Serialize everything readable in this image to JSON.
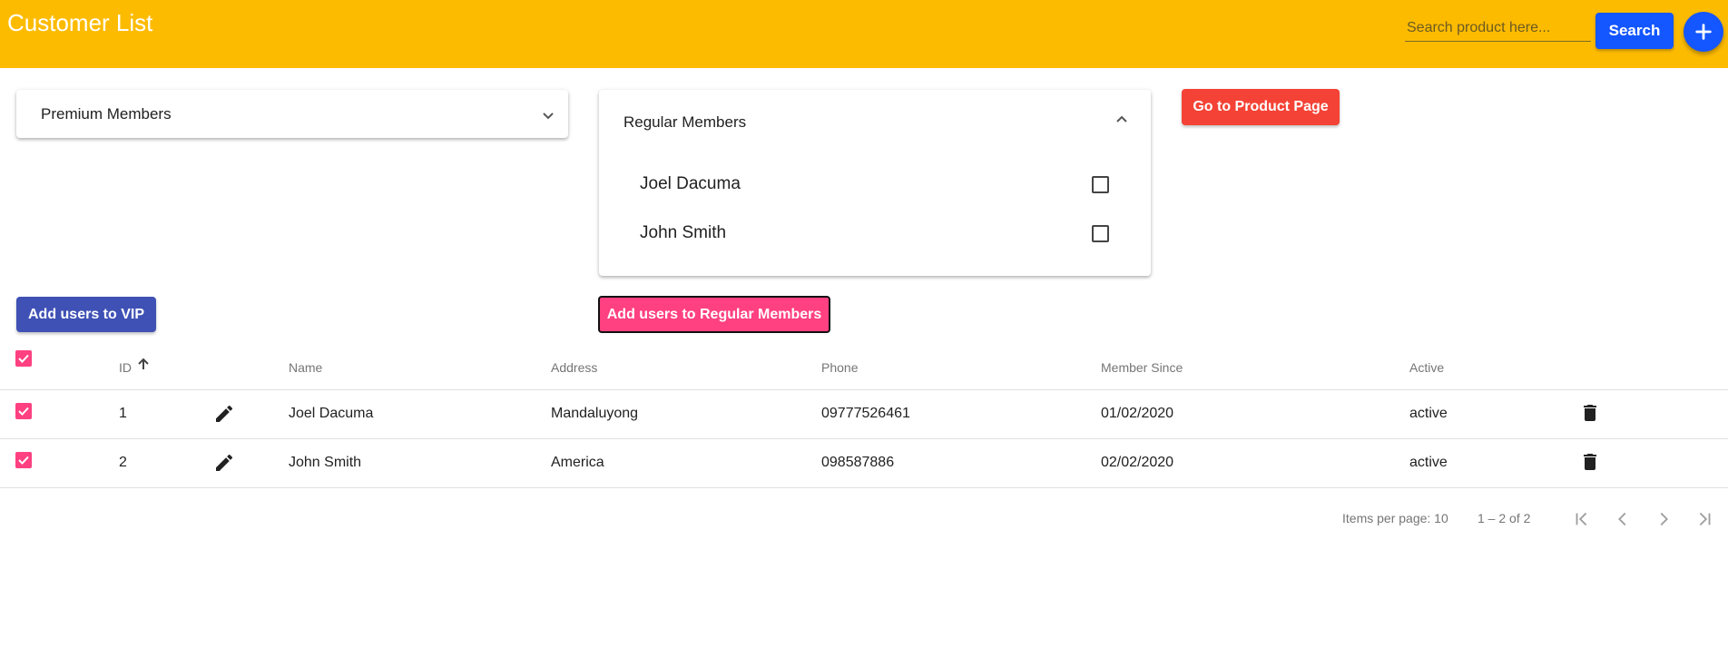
{
  "header": {
    "title": "Customer List",
    "search_placeholder": "Search product here...",
    "search_label": "Search",
    "add_icon": "plus-icon",
    "color": "#fdbb00"
  },
  "panels": {
    "premium": {
      "title": "Premium Members",
      "expanded": false
    },
    "regular": {
      "title": "Regular Members",
      "expanded": true,
      "members": [
        {
          "name": "Joel Dacuma",
          "checked": false
        },
        {
          "name": "John Smith",
          "checked": false
        }
      ]
    }
  },
  "buttons": {
    "product_page": "Go to Product Page",
    "add_vip": "Add users to VIP",
    "add_regular": "Add users to Regular Members"
  },
  "table": {
    "columns": {
      "id": "ID",
      "name": "Name",
      "address": "Address",
      "phone": "Phone",
      "member_since": "Member Since",
      "active": "Active"
    },
    "rows": [
      {
        "id": "1",
        "name": "Joel Dacuma",
        "address": "Mandaluyong",
        "phone": "09777526461",
        "member_since": "01/02/2020",
        "active": "active",
        "selected": true
      },
      {
        "id": "2",
        "name": "John Smith",
        "address": "America",
        "phone": "098587886",
        "member_since": "02/02/2020",
        "active": "active",
        "selected": true
      }
    ]
  },
  "paginator": {
    "items_per_page": "Items per page: 10",
    "range": "1 – 2 of 2"
  },
  "colors": {
    "accent_pink": "#ff4081",
    "primary_blue": "#1456ff",
    "indigo": "#3f51b5",
    "warn_red": "#f44336"
  }
}
